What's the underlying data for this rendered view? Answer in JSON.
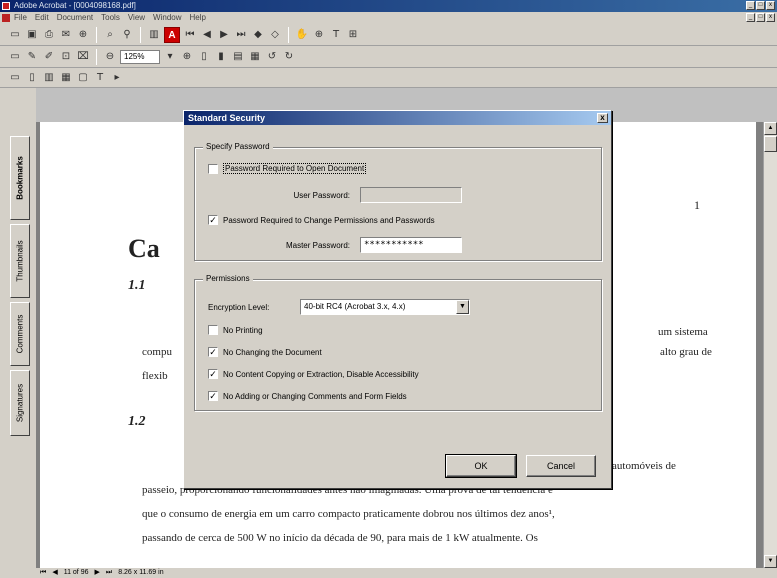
{
  "window": {
    "title": "Adobe Acrobat - [0004098168.pdf]",
    "buttons": [
      "_",
      "□",
      "x"
    ]
  },
  "menu": [
    "File",
    "Edit",
    "Document",
    "Tools",
    "View",
    "Window",
    "Help"
  ],
  "toolbar": {
    "zoom": "125%"
  },
  "nav_tabs": [
    "Bookmarks",
    "Thumbnails",
    "Comments",
    "Signatures"
  ],
  "document": {
    "page_number": "1",
    "chapter_title": "Ca",
    "section_1": "1.1",
    "section_2": "1.2",
    "lines": [
      "um sistema",
      "compu",
      "alto grau de",
      "flexib",
      "automóveis de",
      "passeio, proporcionando funcionalidades antes não imaginadas. Uma prova de tal tendência é",
      "que o consumo de energia em um carro compacto praticamente dobrou nos últimos dez anos¹,",
      "passando de cerca de 500 W no início da década de 90, para mais de 1 kW atualmente. Os"
    ]
  },
  "status": {
    "page": "11 of 96",
    "size": "8.26 x 11.69 in"
  },
  "dialog": {
    "title": "Standard Security",
    "close": "x",
    "specify_group": "Specify Password",
    "open_doc_check": "Password Required to Open Document",
    "open_doc_checked": false,
    "user_password_label": "User Password:",
    "user_password_value": "",
    "change_perms_check": "Password Required to Change Permissions and Passwords",
    "change_perms_checked": true,
    "master_password_label": "Master Password:",
    "master_password_value": "***********",
    "permissions_group": "Permissions",
    "encryption_label": "Encryption Level:",
    "encryption_value": "40-bit RC4 (Acrobat 3.x, 4.x)",
    "perms": [
      {
        "label": "No Printing",
        "checked": false
      },
      {
        "label": "No Changing the Document",
        "checked": true
      },
      {
        "label": "No Content Copying or Extraction, Disable Accessibility",
        "checked": true
      },
      {
        "label": "No Adding or Changing Comments and Form Fields",
        "checked": true
      }
    ],
    "ok": "OK",
    "cancel": "Cancel"
  }
}
